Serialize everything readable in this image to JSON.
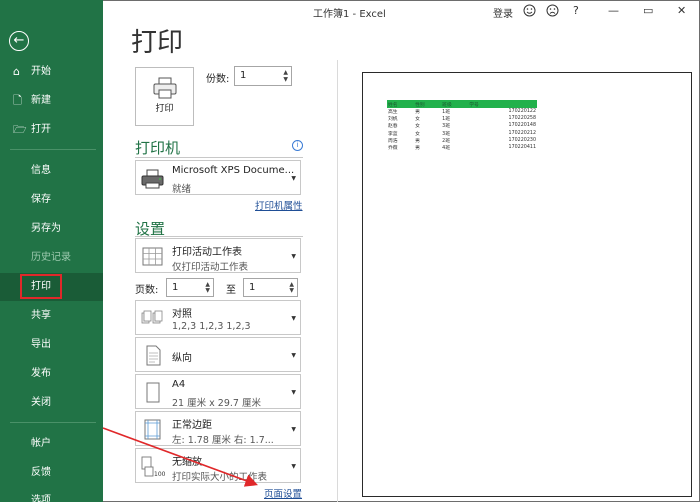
{
  "window": {
    "title": "工作簿1  -  Excel",
    "login": "登录",
    "help": "?",
    "min": "—",
    "restore": "▭",
    "close": "✕"
  },
  "sidebar": {
    "back_icon": "←",
    "items": [
      {
        "label": "开始",
        "icon": "⌂"
      },
      {
        "label": "新建",
        "icon": "🗋"
      },
      {
        "label": "打开",
        "icon": "🗁"
      },
      {
        "label": "信息"
      },
      {
        "label": "保存"
      },
      {
        "label": "另存为"
      },
      {
        "label": "历史记录"
      },
      {
        "label": "打印"
      },
      {
        "label": "共享"
      },
      {
        "label": "导出"
      },
      {
        "label": "发布"
      },
      {
        "label": "关闭"
      },
      {
        "label": "帐户"
      },
      {
        "label": "反馈"
      },
      {
        "label": "选项"
      }
    ]
  },
  "print": {
    "title": "打印",
    "button_label": "打印",
    "copies_label": "份数:",
    "copies_value": "1"
  },
  "printer": {
    "section": "打印机",
    "name": "Microsoft XPS Docume...",
    "status": "就绪",
    "properties_link": "打印机属性",
    "info_icon": "i"
  },
  "settings": {
    "section": "设置",
    "scope": {
      "line1": "打印活动工作表",
      "line2": "仅打印活动工作表"
    },
    "pages_label": "页数:",
    "pages_from": "1",
    "pages_to_label": "至",
    "pages_to": "1",
    "collate": {
      "line1": "对照",
      "line2": "1,2,3     1,2,3     1,2,3"
    },
    "orientation": {
      "line1": "纵向"
    },
    "paper": {
      "line1": "A4",
      "line2": "21 厘米 x 29.7 厘米"
    },
    "margins": {
      "line1": "正常边距",
      "line2": "左: 1.78 厘米   右: 1.7..."
    },
    "scaling": {
      "line1": "无缩放",
      "line2": "打印实际大小的工作表"
    },
    "page_setup_link": "页面设置"
  },
  "preview": {
    "headers": [
      "姓名",
      "性别",
      "班级",
      "学号"
    ],
    "rows": [
      [
        "高生",
        "男",
        "1班",
        "170220122"
      ],
      [
        "刘帆",
        "女",
        "1班",
        "170220258"
      ],
      [
        "赵春",
        "女",
        "3班",
        "170220148"
      ],
      [
        "李蓝",
        "女",
        "3班",
        "170220212"
      ],
      [
        "周浩",
        "男",
        "2班",
        "170220230"
      ],
      [
        "乔薇",
        "男",
        "4班",
        "170220411"
      ]
    ]
  },
  "colors": {
    "sidebar": "#217346",
    "active": "#1a5c37",
    "accent": "#217346",
    "highlight": "#e0282a"
  }
}
